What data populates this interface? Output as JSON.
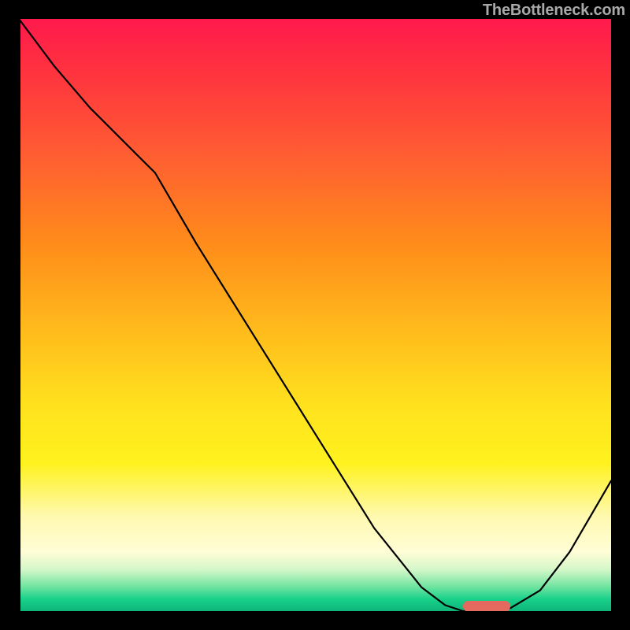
{
  "watermark": "TheBottleneck.com",
  "colors": {
    "gradient_top": "#ff1a4d",
    "gradient_mid1": "#ff8c1a",
    "gradient_mid2": "#ffe11e",
    "gradient_bottom": "#0fb47a",
    "axis": "#000000",
    "line": "#000000",
    "marker": "#e4695e",
    "watermark": "#a8a8a8"
  },
  "chart_data": {
    "type": "line",
    "title": "",
    "xlabel": "",
    "ylabel": "",
    "xlim": [
      0,
      100
    ],
    "ylim": [
      0,
      100
    ],
    "series": [
      {
        "name": "curve",
        "x": [
          0,
          6,
          12,
          20,
          23,
          30,
          40,
          50,
          60,
          68,
          72,
          75,
          80,
          83,
          88,
          93,
          100
        ],
        "values": [
          100,
          92,
          85,
          77,
          74,
          62,
          46,
          30,
          14,
          4,
          1,
          0,
          0,
          0.5,
          3.5,
          10,
          22
        ]
      }
    ],
    "marker": {
      "x_start": 75,
      "x_end": 83,
      "y": 0.8
    },
    "grid": false,
    "legend": false
  }
}
